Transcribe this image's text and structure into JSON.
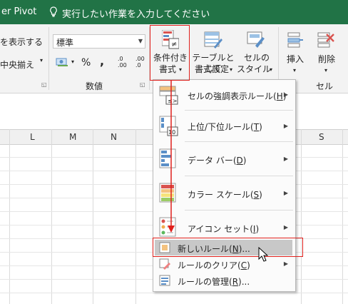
{
  "titlebar": {
    "app_name": "er Pivot",
    "tell_me": "実行したい作業を入力してください"
  },
  "ribbon": {
    "alignment": {
      "wrap_label": "を表示する",
      "merge_label": "中央揃え"
    },
    "number": {
      "format_value": "標準",
      "percent": "%",
      "comma": ",",
      "inc_decimal": ".0 .00",
      "dec_decimal": ".00 .0",
      "group_label": "数値"
    },
    "styles": {
      "cond_format_line1": "条件付き",
      "cond_format_line2": "書式",
      "table_format_line1": "テーブルとして",
      "table_format_line2": "書式設定",
      "cell_style_line1": "セルの",
      "cell_style_line2": "スタイル"
    },
    "cells": {
      "insert_label": "挿入",
      "delete_label": "削除",
      "group_label": "セル"
    }
  },
  "grid": {
    "columns": [
      "L",
      "M",
      "N",
      "S"
    ]
  },
  "menu": {
    "items": [
      {
        "label": "セルの強調表示ルール",
        "key": "H"
      },
      {
        "label": "上位/下位ルール",
        "key": "T"
      },
      {
        "label": "データ バー",
        "key": "D"
      },
      {
        "label": "カラー スケール",
        "key": "S"
      },
      {
        "label": "アイコン セット",
        "key": "I"
      },
      {
        "label": "新しいルール",
        "key": "N",
        "suffix": "..."
      },
      {
        "label": "ルールのクリア",
        "key": "C"
      },
      {
        "label": "ルールの管理",
        "key": "R",
        "suffix": "..."
      }
    ],
    "icon_text": {
      "le": "≤>",
      "ten": "10",
      "ne": "≠"
    }
  },
  "colors": {
    "excel_green": "#217346",
    "annotation_red": "#e0201c",
    "hover_gray": "#c8c8c8"
  }
}
